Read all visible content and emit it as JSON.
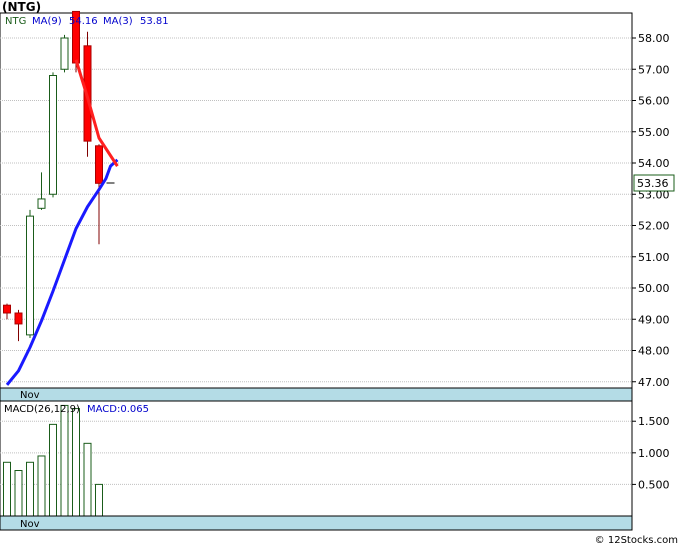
{
  "title": "(NTG)",
  "footer": "© 12Stocks.com",
  "colors": {
    "up_candle": "#1a5c1a",
    "down_candle": "#ff0000",
    "ma9": "#1a1aff",
    "ma3": "#ff2020",
    "macd_bar": "#1a5c1a",
    "axis_band": "#b4dce6",
    "grid": "#c0c0c0",
    "legend_text": "#0000cc"
  },
  "chart_data": [
    {
      "type": "candlestick",
      "title": "",
      "legend": {
        "symbol": "NTG",
        "ma9_label": "MA(9)",
        "ma9_value": "54.16",
        "ma3_label": "MA(3)",
        "ma3_value": "53.81"
      },
      "x_label": "Nov",
      "x_label_index": 2,
      "y_ticks": [
        "47.00",
        "48.00",
        "49.00",
        "50.00",
        "51.00",
        "52.00",
        "53.00",
        "54.00",
        "55.00",
        "56.00",
        "57.00",
        "58.00"
      ],
      "ylim": [
        46.8,
        58.8
      ],
      "last_price": "53.36",
      "last_price_value": 53.36,
      "candles": [
        {
          "o": 49.45,
          "h": 49.5,
          "l": 49.0,
          "c": 49.2
        },
        {
          "o": 49.2,
          "h": 49.3,
          "l": 48.3,
          "c": 48.85
        },
        {
          "o": 48.5,
          "h": 52.5,
          "l": 48.4,
          "c": 52.3
        },
        {
          "o": 52.55,
          "h": 53.7,
          "l": 52.5,
          "c": 52.85
        },
        {
          "o": 53.0,
          "h": 56.9,
          "l": 52.9,
          "c": 56.8
        },
        {
          "o": 57.0,
          "h": 58.1,
          "l": 56.9,
          "c": 58.0
        },
        {
          "o": 58.85,
          "h": 58.85,
          "l": 56.9,
          "c": 57.2
        },
        {
          "o": 57.75,
          "h": 58.2,
          "l": 54.2,
          "c": 54.7
        },
        {
          "o": 54.55,
          "h": 54.6,
          "l": 51.4,
          "c": 53.35
        },
        {
          "o": 53.36,
          "h": 53.36,
          "l": 53.36,
          "c": 53.36
        }
      ],
      "ma9": [
        46.9,
        47.35,
        48.1,
        48.95,
        49.9,
        50.9,
        51.9,
        52.6,
        53.15,
        53.5,
        53.9,
        54.1
      ],
      "ma9_x": [
        0,
        1,
        2,
        3,
        4,
        5,
        6,
        7,
        8,
        8.6,
        9,
        9.6
      ],
      "ma3": [
        57.3,
        56.1,
        54.8,
        53.9
      ],
      "ma3_x": [
        6,
        7,
        8,
        9.6
      ]
    },
    {
      "type": "bar",
      "title": "",
      "legend": {
        "label": "MACD(26,12,9)",
        "value_label": "MACD:0.065"
      },
      "x_label": "Nov",
      "x_label_index": 2,
      "y_ticks": [
        "0.500",
        "1.000",
        "1.500"
      ],
      "ylim": [
        0,
        1.82
      ],
      "values": [
        0.85,
        0.72,
        0.85,
        0.95,
        1.45,
        1.75,
        1.7,
        1.15,
        0.5
      ]
    }
  ]
}
